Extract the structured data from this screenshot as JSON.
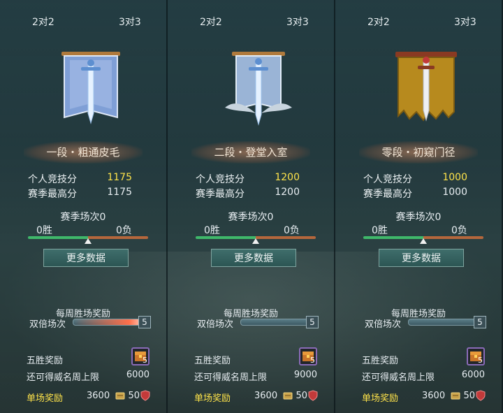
{
  "panels": [
    {
      "tab_a": "2对2",
      "tab_b": "3对3",
      "banner_icon": "silver-sword-banner-icon",
      "rank_title": "一段・粗通皮毛",
      "personal_score_label": "个人竞技分",
      "personal_score": "1175",
      "season_high_label": "赛季最高分",
      "season_high": "1175",
      "season_matches": "赛季场次0",
      "wins": "0胜",
      "losses": "0负",
      "win_ratio": 0.5,
      "more_data": "更多数据",
      "weekly_reward_title": "每周胜场奖励",
      "double_label": "双倍场次",
      "double_count": "5",
      "double_fill": 1.0,
      "five_win_label": "五胜奖励",
      "chest_count": "5",
      "limit_label": "还可得威名周上限",
      "limit_value": "6000",
      "single_label": "单场奖励",
      "single_a": "3600",
      "single_b": "50"
    },
    {
      "tab_a": "2对2",
      "tab_b": "3对3",
      "banner_icon": "winged-sword-banner-icon",
      "rank_title": "二段・登堂入室",
      "personal_score_label": "个人竞技分",
      "personal_score": "1200",
      "season_high_label": "赛季最高分",
      "season_high": "1200",
      "season_matches": "赛季场次0",
      "wins": "0胜",
      "losses": "0负",
      "win_ratio": 0.5,
      "more_data": "更多数据",
      "weekly_reward_title": "每周胜场奖励",
      "double_label": "双倍场次",
      "double_count": "5",
      "double_fill": 0.0,
      "five_win_label": "五胜奖励",
      "chest_count": "5",
      "limit_label": "还可得威名周上限",
      "limit_value": "9000",
      "single_label": "单场奖励",
      "single_a": "3600",
      "single_b": "50"
    },
    {
      "tab_a": "2对2",
      "tab_b": "3对3",
      "banner_icon": "tattered-gold-banner-icon",
      "rank_title": "零段・初窥门径",
      "personal_score_label": "个人竞技分",
      "personal_score": "1000",
      "season_high_label": "赛季最高分",
      "season_high": "1000",
      "season_matches": "赛季场次0",
      "wins": "0胜",
      "losses": "0负",
      "win_ratio": 0.5,
      "more_data": "更多数据",
      "weekly_reward_title": "每周胜场奖励",
      "double_label": "双倍场次",
      "double_count": "5",
      "double_fill": 0.0,
      "five_win_label": "五胜奖励",
      "chest_count": "5",
      "limit_label": "还可得威名周上限",
      "limit_value": "6000",
      "single_label": "单场奖励",
      "single_a": "3600",
      "single_b": "50"
    }
  ],
  "colors": {
    "highlight": "#ffe44a",
    "win_bar": "#3fb86a",
    "loss_bar": "#b5673c",
    "button": "#3f6e6b"
  }
}
